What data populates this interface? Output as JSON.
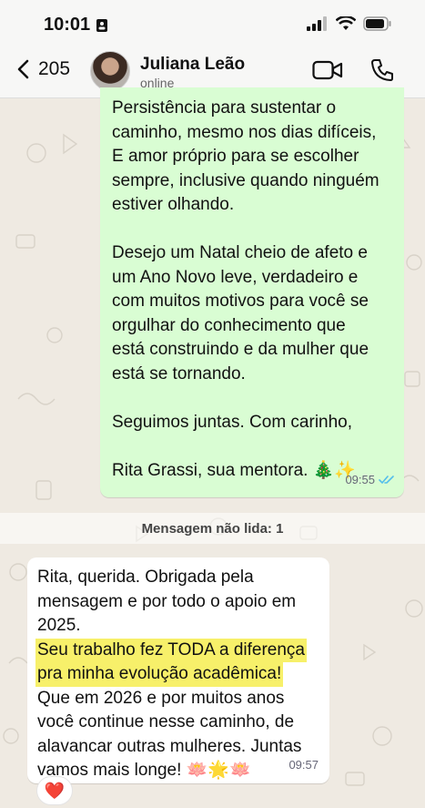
{
  "status_bar": {
    "time": "10:01"
  },
  "header": {
    "back_count": "205",
    "contact_name": "Juliana Leão",
    "contact_status": "online"
  },
  "outgoing": {
    "lines": [
      "Persistência para sustentar o",
      "caminho, mesmo nos dias difíceis,",
      "E amor próprio para se escolher",
      "sempre, inclusive quando ninguém",
      "estiver olhando.",
      "",
      "Desejo um Natal cheio de afeto e",
      "um Ano Novo leve, verdadeiro e",
      "com muitos motivos para você se",
      "orgulhar do conhecimento que",
      "está construindo e da mulher que",
      "está se tornando.",
      "",
      "Seguimos juntas. Com carinho,",
      "",
      "Rita Grassi, sua mentora. 🎄✨"
    ],
    "time": "09:55"
  },
  "unread_label": "Mensagem não lida: 1",
  "incoming": {
    "lines": [
      "Rita, querida. Obrigada pela",
      "mensagem e por todo o apoio em",
      "2025.",
      "Seu trabalho fez TODA a diferença",
      "pra minha evolução acadêmica!",
      "Que em 2026 e por muitos anos",
      "você continue nesse caminho, de",
      "alavancar outras mulheres. Juntas",
      "vamos mais longe! 🪷🌟🪷"
    ],
    "time": "09:57",
    "reaction": "❤️"
  },
  "colors": {
    "outgoing_bubble": "#d9fdd3",
    "incoming_bubble": "#ffffff",
    "highlight": "#f7f06a",
    "read_ticks": "#53bdeb"
  }
}
